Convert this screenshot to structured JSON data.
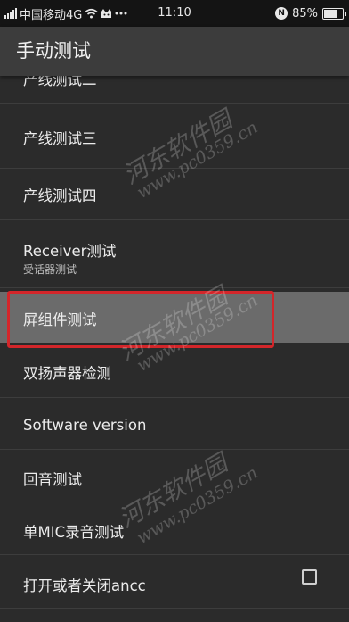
{
  "status_bar": {
    "carrier": "中国移动4G",
    "time": "11:10",
    "battery_percent": "85%",
    "battery_level": 0.85,
    "nfc_badge": "N",
    "icons": [
      "signal-icon",
      "wifi-icon",
      "usb-debug-icon",
      "notification-more-icon",
      "nfc-icon",
      "battery-icon"
    ]
  },
  "header": {
    "title": "手动测试"
  },
  "list": {
    "items": [
      {
        "label": "产线测试二"
      },
      {
        "label": "产线测试三"
      },
      {
        "label": "产线测试四"
      },
      {
        "label": "Receiver测试",
        "sublabel": "受话器测试"
      },
      {
        "label": "屏组件测试"
      },
      {
        "label": "双扬声器检测"
      },
      {
        "label": "Software version"
      },
      {
        "label": "回音测试"
      },
      {
        "label": "单MIC录音测试"
      },
      {
        "label": "打开或者关闭ancc",
        "checked": false
      }
    ]
  },
  "watermark": {
    "site_name": "河东软件园",
    "url": "www.pc0359.cn"
  },
  "colors": {
    "highlight": "#d3262a",
    "selected_row": "#6b6b6b",
    "background": "#2b2b2b",
    "action_bar": "#3c3c3c"
  }
}
